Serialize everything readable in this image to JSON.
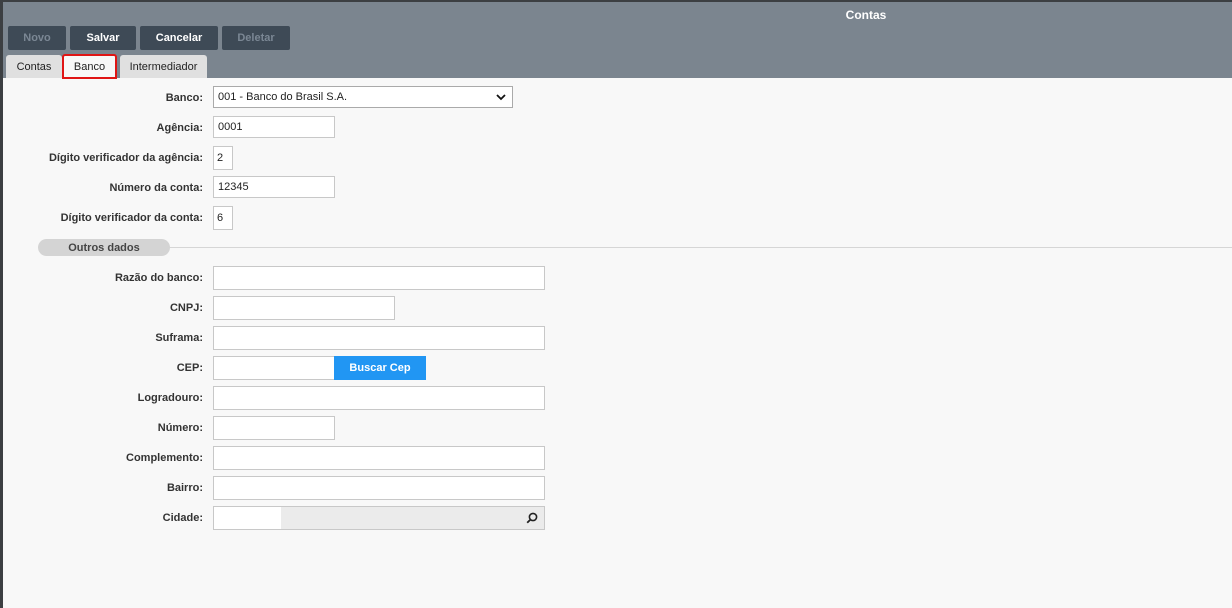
{
  "header": {
    "title": "Contas",
    "toolbar": [
      {
        "label": "Novo",
        "enabled": false
      },
      {
        "label": "Salvar",
        "enabled": true
      },
      {
        "label": "Cancelar",
        "enabled": true
      },
      {
        "label": "Deletar",
        "enabled": false
      }
    ],
    "tabs": [
      {
        "label": "Contas"
      },
      {
        "label": "Banco",
        "active": true
      },
      {
        "label": "Intermediador"
      }
    ]
  },
  "bank": {
    "banco": {
      "label": "Banco:",
      "value": "001 - Banco do Brasil S.A."
    },
    "agencia": {
      "label": "Agência:",
      "value": "0001"
    },
    "digito_agencia": {
      "label": "Dígito verificador da agência:",
      "value": "2"
    },
    "numero_conta": {
      "label": "Número da conta:",
      "value": "12345"
    },
    "digito_conta": {
      "label": "Dígito verificador da conta:",
      "value": "6"
    }
  },
  "outros": {
    "section_title": "Outros dados",
    "razao": {
      "label": "Razão do banco:",
      "value": ""
    },
    "cnpj": {
      "label": "CNPJ:",
      "value": ""
    },
    "suframa": {
      "label": "Suframa:",
      "value": ""
    },
    "cep": {
      "label": "CEP:",
      "value": "",
      "button": "Buscar Cep"
    },
    "logradouro": {
      "label": "Logradouro:",
      "value": ""
    },
    "numero": {
      "label": "Número:",
      "value": ""
    },
    "complemento": {
      "label": "Complemento:",
      "value": ""
    },
    "bairro": {
      "label": "Bairro:",
      "value": ""
    },
    "cidade": {
      "label": "Cidade:",
      "value": ""
    }
  },
  "colors": {
    "header_bg": "#7b858f",
    "toolbar_button": "#3e4a56",
    "accent": "#2196f3",
    "active_tab_outline": "#e01515"
  },
  "icons": [
    "chevron-down-icon",
    "search-icon"
  ]
}
